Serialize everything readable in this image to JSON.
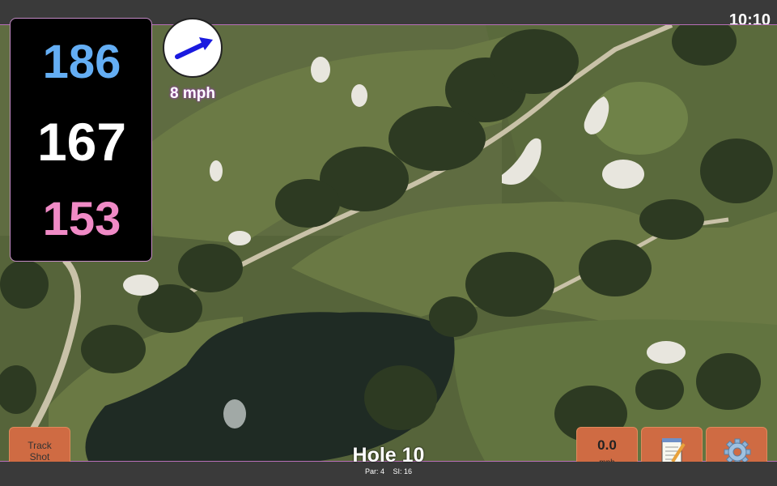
{
  "status_bar": {
    "time": "10:10"
  },
  "distances": {
    "back": "186",
    "middle": "167",
    "front": "153"
  },
  "wind": {
    "speed": "8 mph",
    "icon": "wind-arrow-icon"
  },
  "buttons": {
    "track_shot": "Track Shot",
    "speed_value": "0.0",
    "speed_unit": "mph",
    "notes_icon": "notepad-icon",
    "settings_icon": "gear-icon"
  },
  "hole": {
    "title": "Hole 10",
    "par": "Par: 4",
    "stroke_index": "SI: 16"
  },
  "colors": {
    "back_distance": "#64aef4",
    "middle_distance": "#ffffff",
    "front_distance": "#f08ac6",
    "button": "#cf6b43",
    "panel_border": "#c48bc7"
  }
}
